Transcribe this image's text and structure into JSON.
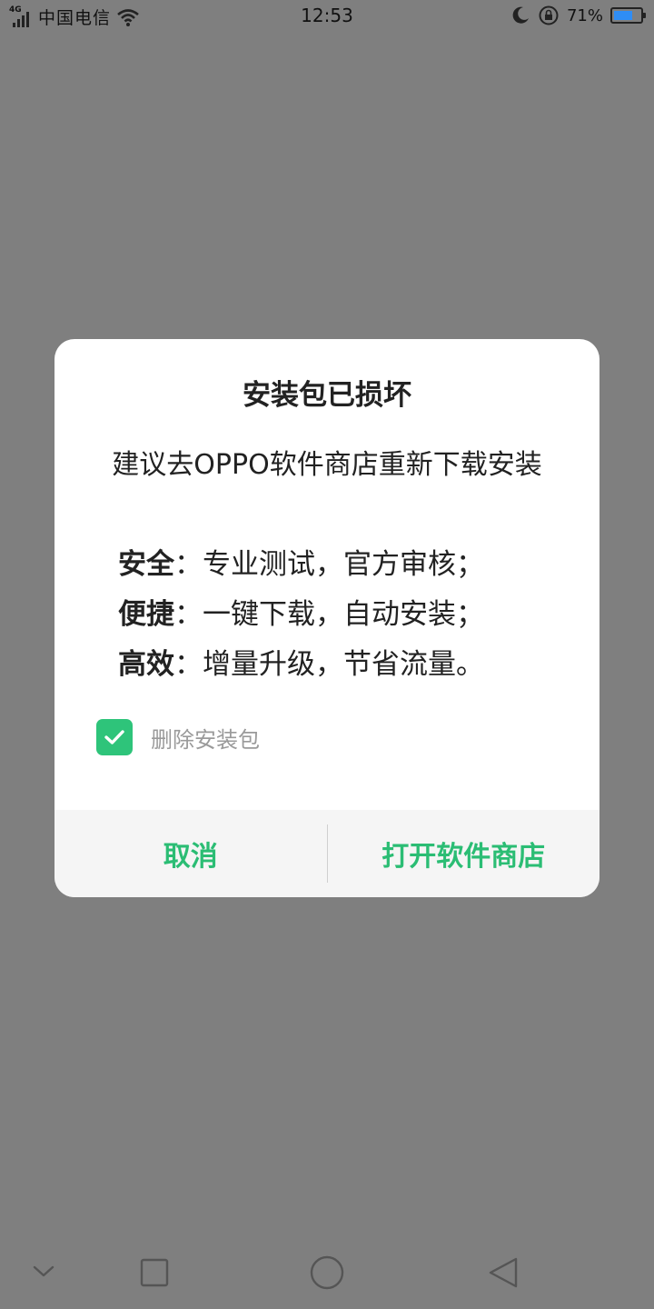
{
  "status_bar": {
    "network_type": "4G",
    "carrier": "中国电信",
    "time": "12:53",
    "battery_percent": "71%",
    "battery_level": 0.71,
    "icons": [
      "signal-icon",
      "wifi-icon",
      "moon-icon",
      "rotation-lock-icon",
      "battery-icon"
    ]
  },
  "dialog": {
    "title": "安装包已损坏",
    "message": "建议去OPPO软件商店重新下载安装",
    "features": [
      {
        "key": "安全",
        "text": "：专业测试，官方审核；"
      },
      {
        "key": "便捷",
        "text": "：一键下载，自动安装；"
      },
      {
        "key": "高效",
        "text": "：增量升级，节省流量。"
      }
    ],
    "checkbox": {
      "label": "删除安装包",
      "checked": true
    },
    "buttons": {
      "cancel": "取消",
      "confirm": "打开软件商店"
    }
  },
  "colors": {
    "accent": "#2bbd74",
    "checkbox": "#2ec47a",
    "overlay": "#7f7f7f"
  },
  "nav_bar": {
    "icons": [
      "chevron-down-icon",
      "recents-icon",
      "home-icon",
      "back-icon"
    ]
  }
}
